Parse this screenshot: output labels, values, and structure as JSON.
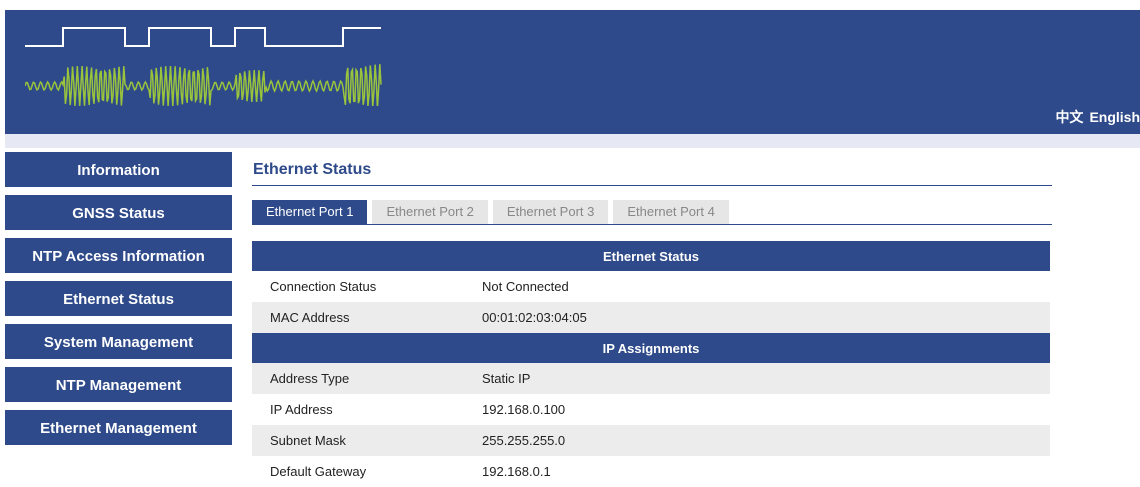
{
  "header": {
    "lang_zh": "中文",
    "lang_en": "English"
  },
  "sidebar": {
    "items": [
      {
        "label": "Information"
      },
      {
        "label": "GNSS Status"
      },
      {
        "label": "NTP Access Information"
      },
      {
        "label": "Ethernet Status"
      },
      {
        "label": "System Management"
      },
      {
        "label": "NTP Management"
      },
      {
        "label": "Ethernet Management"
      }
    ]
  },
  "main": {
    "title": "Ethernet Status",
    "tabs": [
      {
        "label": "Ethernet Port 1",
        "active": true
      },
      {
        "label": "Ethernet Port 2",
        "active": false
      },
      {
        "label": "Ethernet Port 3",
        "active": false
      },
      {
        "label": "Ethernet Port 4",
        "active": false
      }
    ],
    "ethernet_section": {
      "heading": "Ethernet Status",
      "rows": [
        {
          "label": "Connection Status",
          "value": "Not Connected"
        },
        {
          "label": "MAC Address",
          "value": "00:01:02:03:04:05"
        }
      ]
    },
    "ip_section": {
      "heading": "IP Assignments",
      "rows": [
        {
          "label": "Address Type",
          "value": "Static IP"
        },
        {
          "label": "IP Address",
          "value": "192.168.0.100"
        },
        {
          "label": "Subnet Mask",
          "value": "255.255.255.0"
        },
        {
          "label": "Default Gateway",
          "value": "192.168.0.1"
        }
      ]
    }
  },
  "colors": {
    "brand": "#2e4a8a",
    "waveform": "#9ac43c",
    "row_alt": "#ececec",
    "tab_inactive": "#e6e6e6"
  }
}
